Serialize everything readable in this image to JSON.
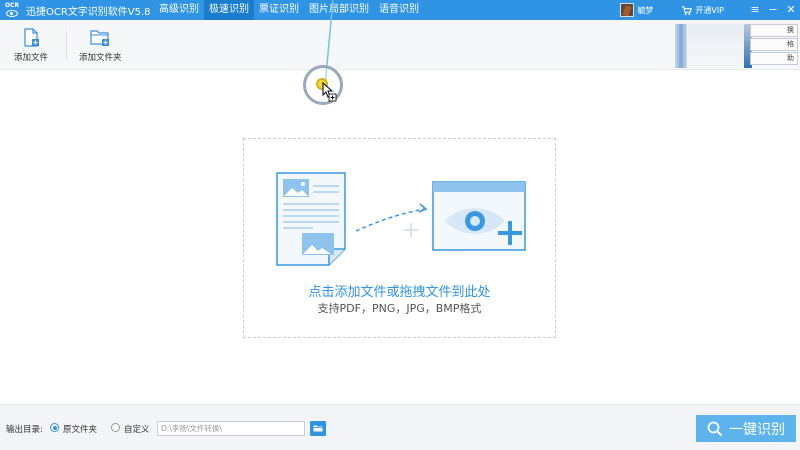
{
  "app": {
    "logo_text": "OCR",
    "title": "迅捷OCR文字识别软件V5.8"
  },
  "tabs": [
    {
      "label": "高级识别"
    },
    {
      "label": "极速识别"
    },
    {
      "label": "票证识别"
    },
    {
      "label": "图片局部识别"
    },
    {
      "label": "语音识别"
    }
  ],
  "active_tab": "极速识别",
  "titlebar_right": {
    "user_name": "毓梦",
    "vip_label": "开通VIP",
    "menu_icon": "menu-icon",
    "minimize_icon": "minimize-icon",
    "close_icon": "close-icon"
  },
  "toolbar": {
    "add_file_label": "添加文件",
    "add_folder_label": "添加文件夹",
    "side_buttons": [
      "换",
      "格",
      "助"
    ]
  },
  "drop_zone": {
    "main_text": "点击添加文件或拖拽文件到此处",
    "sub_text": "支持PDF，PNG，JPG，BMP格式"
  },
  "bottom": {
    "output_label": "输出目录:",
    "option_original": "原文件夹",
    "option_custom": "自定义",
    "path_value": "D:\\李扬\\文件转换\\",
    "recognize_label": "一键识别"
  },
  "colors": {
    "accent": "#2f94e4",
    "accent_dark": "#1a7ccc",
    "button": "#5db3ec"
  }
}
